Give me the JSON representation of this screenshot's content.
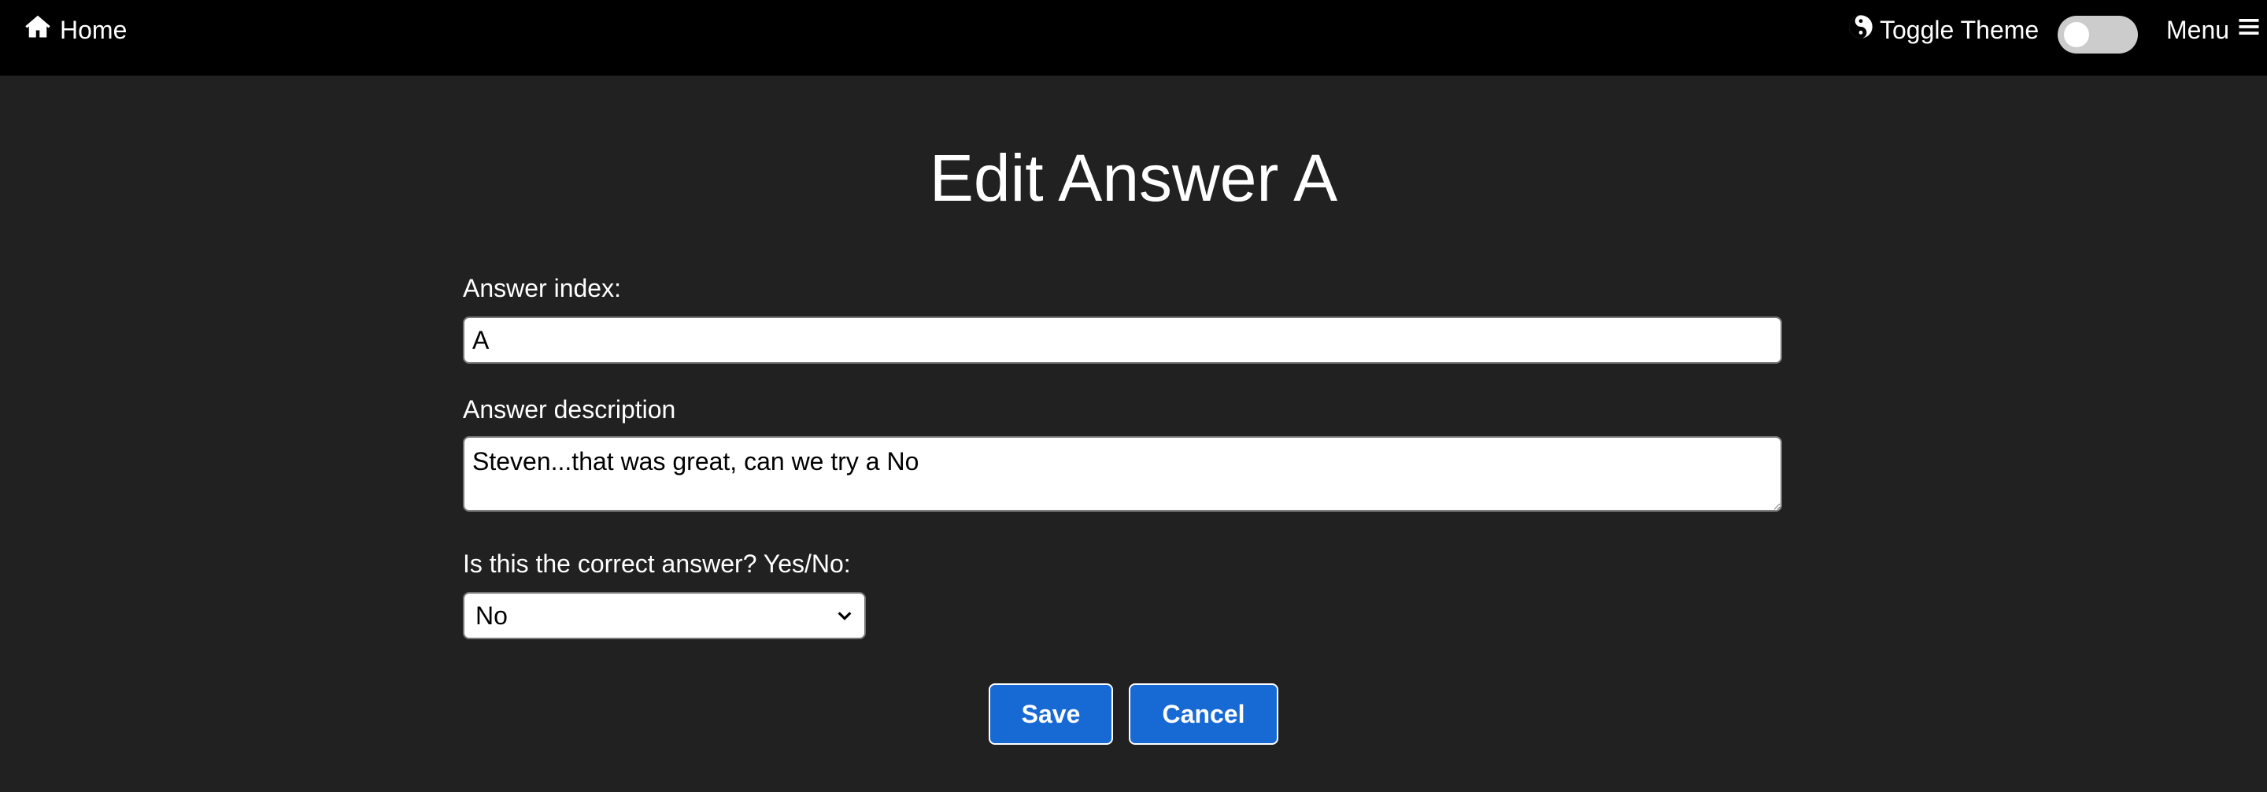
{
  "nav": {
    "home_label": "Home",
    "theme_label": "Toggle Theme",
    "menu_label": "Menu"
  },
  "page": {
    "title": "Edit Answer A"
  },
  "form": {
    "index_label": "Answer index:",
    "index_value": "A",
    "description_label": "Answer description",
    "description_value": "Steven...that was great, can we try a No",
    "correct_label": "Is this the correct answer? Yes/No:",
    "correct_selected": "No",
    "save_label": "Save",
    "cancel_label": "Cancel"
  },
  "colors": {
    "navbar_bg": "#000000",
    "page_bg": "#212121",
    "button_blue": "#1769d4"
  },
  "icons": {
    "home": "home-icon",
    "theme": "yin-yang-icon",
    "menu": "hamburger-icon",
    "select": "chevron-down-icon"
  }
}
